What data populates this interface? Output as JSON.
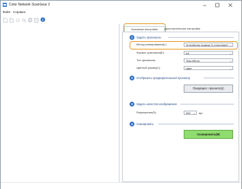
{
  "window": {
    "title": "Color Network ScanGear 2"
  },
  "menu": [
    "Файл",
    "Справка"
  ],
  "tabs": [
    "Основные настройки",
    "Дополнительные настройки"
  ],
  "sections": {
    "s1": {
      "number": "1",
      "title": "Задать оригиналы"
    },
    "s2": {
      "number": "2",
      "title": "Отобразить предварительный просмотр"
    },
    "s3": {
      "number": "3",
      "title": "Задать качество изображения"
    },
    "s4": {
      "number": "4",
      "title": "Сканировать"
    }
  },
  "fields": {
    "scan_method": {
      "label": "Метод сканирования(L):",
      "value": "Устройство подачи (1-стороннее)"
    },
    "paper_size": {
      "label": "Формат оригинала(E):",
      "value": "A4"
    },
    "original_type": {
      "label": "Тип оригинала:",
      "value": "Текст/Фото"
    },
    "color_mode": {
      "label": "Цветной режим(C):",
      "value": "Цвет"
    },
    "resolution": {
      "label": "Разрешение(S):",
      "value": "200",
      "unit": "dpi"
    }
  },
  "buttons": {
    "preview": "Предварит. просмотр(I)",
    "scan": "Сканировать(M)"
  },
  "colors": {
    "highlight": "#e6961e",
    "badge": "#2f6fc4",
    "scan_button": "#8fdd6e"
  }
}
